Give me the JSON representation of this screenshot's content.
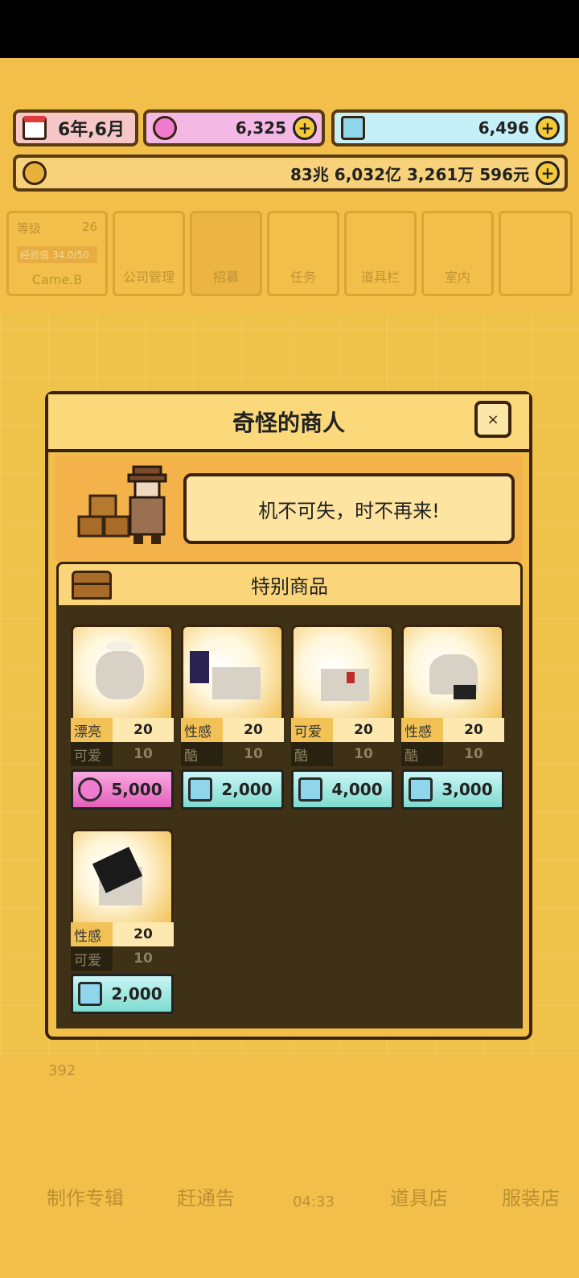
{
  "topbar": {
    "date": "6年,6月",
    "gems": "6,325",
    "diamonds": "6,496",
    "money": "83兆 6,032亿 3,261万 596元"
  },
  "bg_menu": {
    "level_label": "等级",
    "level_value": "26",
    "exp_label": "经验值 34.0/50",
    "company_name": "Came.B",
    "items": [
      "公司管理",
      "招募",
      "任务",
      "道具栏",
      "室内"
    ]
  },
  "bg_bottom": {
    "count": "392",
    "timer": "04:33",
    "items": [
      "制作专辑",
      "赶通告",
      "道具店",
      "服装店"
    ]
  },
  "modal": {
    "title": "奇怪的商人",
    "close_icon": "×",
    "message": "机不可失，时不再来!",
    "section_title": "特别商品"
  },
  "items": [
    {
      "stat1": "漂亮",
      "val1": "20",
      "stat2": "可爱",
      "val2": "10",
      "currency": "gem",
      "price": "5,000"
    },
    {
      "stat1": "性感",
      "val1": "20",
      "stat2": "酷",
      "val2": "10",
      "currency": "diamond",
      "price": "2,000"
    },
    {
      "stat1": "可爱",
      "val1": "20",
      "stat2": "酷",
      "val2": "10",
      "currency": "diamond",
      "price": "4,000"
    },
    {
      "stat1": "性感",
      "val1": "20",
      "stat2": "酷",
      "val2": "10",
      "currency": "diamond",
      "price": "3,000"
    },
    {
      "stat1": "性感",
      "val1": "20",
      "stat2": "可爱",
      "val2": "10",
      "currency": "diamond",
      "price": "2,000"
    }
  ]
}
